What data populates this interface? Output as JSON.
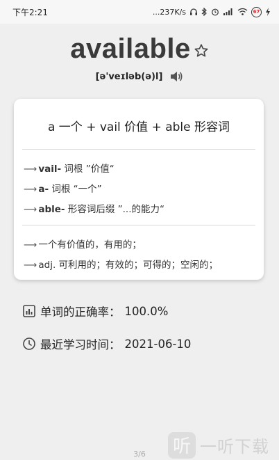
{
  "status_bar": {
    "time": "下午2:21",
    "network_speed": "...237K/s",
    "battery_level": "67"
  },
  "word": {
    "text": "available",
    "phonetic": "[ə'veɪləb(ə)l]"
  },
  "card": {
    "formula": "a 一个 + vail 价值 + able 形容词",
    "roots": [
      {
        "arrow": "⟶",
        "root": "vail-",
        "meaning": " 词根 ”价值“"
      },
      {
        "arrow": "⟶",
        "root": "a-",
        "meaning": " 词根 “一个”"
      },
      {
        "arrow": "⟶",
        "root": "able-",
        "meaning": " 形容词后缀 ”...的能力“"
      }
    ],
    "definitions": [
      {
        "arrow": "⟶",
        "text": "一个有价值的，有用的；"
      },
      {
        "arrow": "⟶",
        "text": "adj. 可利用的；有效的；可得的；空闲的；"
      }
    ]
  },
  "stats": {
    "accuracy_label": "单词的正确率：",
    "accuracy_value": "100.0%",
    "recent_label": "最近学习时间：",
    "recent_value": "2021-06-10"
  },
  "pager": {
    "text": "3/6"
  },
  "watermark": {
    "logo_glyph": "听",
    "text": "一听下载"
  },
  "colors": {
    "background": "#efefef",
    "card": "#ffffff",
    "word": "#3a3a3a"
  }
}
